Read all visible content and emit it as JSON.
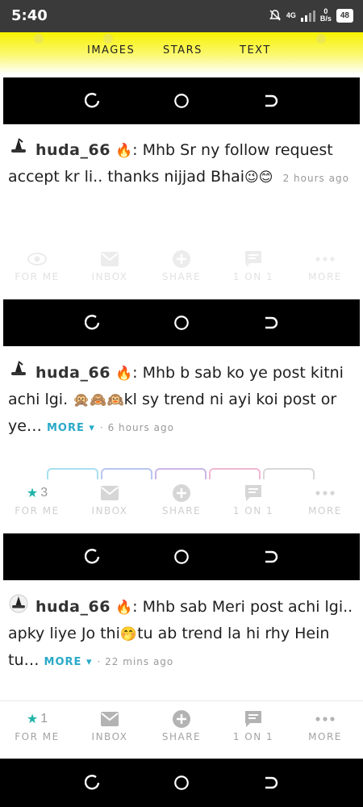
{
  "status": {
    "time": "5:40",
    "network_label": "4G",
    "net_speed_value": "0",
    "net_speed_unit": "B/s",
    "battery": "48"
  },
  "tabs": [
    {
      "label": "IMAGES"
    },
    {
      "label": "STARS"
    },
    {
      "label": "TEXT"
    }
  ],
  "posts": [
    {
      "username": "huda_66",
      "message": "Mhb Sr ny follow request accept kr li.. thanks nijjad Bhai",
      "emojis": "😉😊",
      "time": "2 hours ago",
      "more": ""
    },
    {
      "username": "huda_66",
      "message": "Mhb b sab ko ye post kitni achi lgi.",
      "emojis": "🙊🙈🙉",
      "message2": "kl sy trend ni ayi koi post or ye…",
      "more": "MORE ▾",
      "time": "6 hours ago"
    },
    {
      "username": "huda_66",
      "message": "Mhb sab Meri post achi lgi.. apky liye Jo thi",
      "emoji": "🤭",
      "message2": "tu ab trend la hi rhy Hein tu…",
      "more": "MORE ▾",
      "time": "22 mins ago"
    }
  ],
  "actions": {
    "for_me": "FOR ME",
    "inbox": "INBOX",
    "share": "SHARE",
    "one_on_one": "1 ON 1",
    "more": "MORE",
    "post2_star_count": "3",
    "post3_star_count": "1"
  },
  "colors": {
    "tab_yellow": "#f7f200",
    "link_teal": "#2aa9c9",
    "star_teal": "#1fb3a8"
  }
}
